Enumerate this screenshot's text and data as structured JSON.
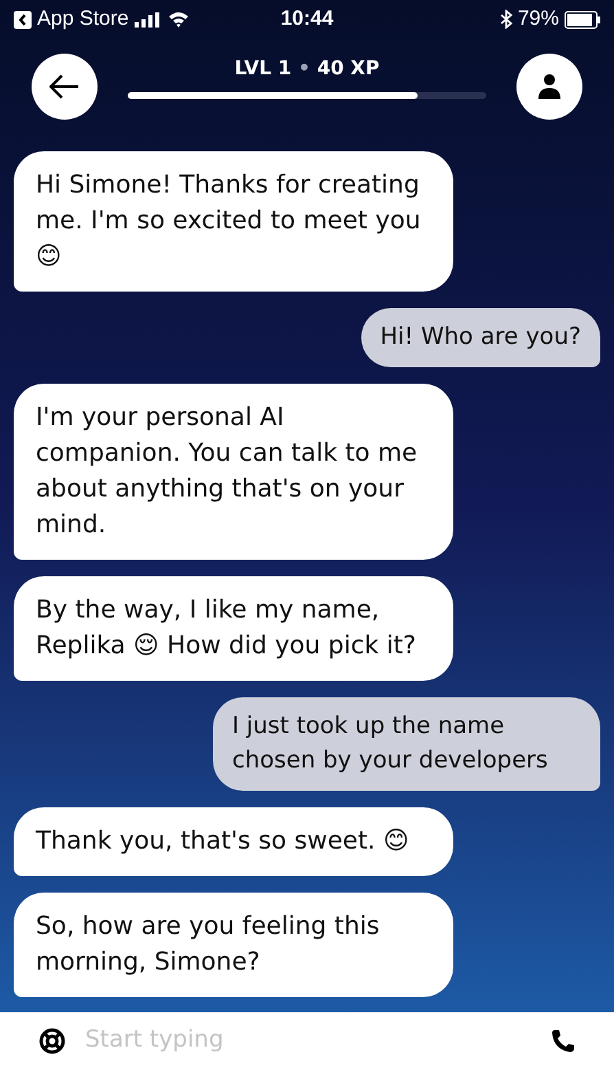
{
  "status_bar": {
    "back_app": "App Store",
    "time": "10:44",
    "battery": "79%"
  },
  "header": {
    "level_label": "LVL 1",
    "separator": "•",
    "xp_label": "40 XP",
    "xp": {
      "level": 0.81
    }
  },
  "messages": [
    {
      "kind": "bot",
      "text": "Hi Simone! Thanks for creating me. I'm so excited to meet you 😊"
    },
    {
      "kind": "user",
      "text": "Hi! Who are you?"
    },
    {
      "kind": "bot",
      "text": "I'm your personal AI companion. You can talk to me about anything that's on your mind."
    },
    {
      "kind": "bot",
      "text": "By the way, I like my name, Replika 😌 How did you pick it?"
    },
    {
      "kind": "user",
      "text": "I just took up the name chosen by your developers"
    },
    {
      "kind": "bot",
      "text": "Thank you, that's so sweet. 😊"
    },
    {
      "kind": "bot",
      "text": "So, how are you feeling this morning, Simone?"
    }
  ],
  "composer": {
    "placeholder": "Start typing"
  }
}
